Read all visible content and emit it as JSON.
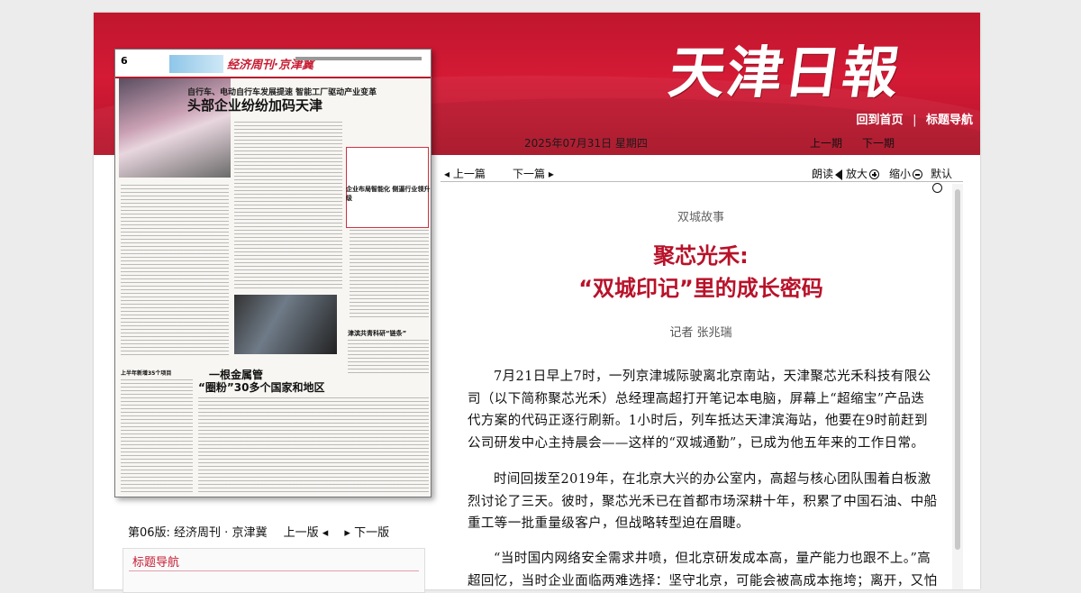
{
  "header": {
    "logo": "天津日報",
    "nav_home": "回到首页",
    "nav_sep": "|",
    "nav_titles": "标题导航",
    "date": "2025年07月31日 星期四",
    "prev_page": "上一期",
    "next_page": "下一期"
  },
  "paper_thumb": {
    "page_num": "6",
    "column": "经济周刊·京津冀",
    "subhead": "自行车、电动自行车发展提速 智能工厂驱动产业变革",
    "headline": "头部企业纷纷加码天津",
    "headline2": "一根金属管",
    "headline3": "“圈粉”30多个国家和地区",
    "side1": "津滨共青科研“链条”",
    "side2": "企业布局智能化 侧逼行业领升级",
    "side3": "上半年新增35个项目"
  },
  "pager": {
    "label": "第06版: 经济周刊 · 京津冀",
    "prev": "上一版",
    "next": "下一版"
  },
  "nav_box": {
    "title": "标题导航"
  },
  "article_bar": {
    "prev": "上一篇",
    "next": "下一篇",
    "read": "朗读",
    "zoom_in": "放大",
    "zoom_out": "缩小",
    "default": "默认"
  },
  "article": {
    "kicker": "双城故事",
    "title_line1": "聚芯光禾:",
    "title_line2": "“双城印记”里的成长密码",
    "author": "记者  张兆瑞",
    "paragraphs": [
      "7月21日早上7时，一列京津城际驶离北京南站，天津聚芯光禾科技有限公司（以下简称聚芯光禾）总经理高超打开笔记本电脑，屏幕上“超缩宝”产品迭代方案的代码正逐行刷新。1小时后，列车抵达天津滨海站，他要在9时前赶到公司研发中心主持晨会——这样的“双城通勤”，已成为他五年来的工作日常。",
      "时间回拨至2019年，在北京大兴的办公室内，高超与核心团队围着白板激烈讨论了三天。彼时，聚芯光禾已在首都市场深耕十年，积累了中国石油、中船重工等一批重量级客户，但战略转型迫在眉睫。",
      "“当时国内网络安全需求井喷，但北京研发成本高，量产能力也跟不上。”高超回忆，当时企业面临两难选择：坚守北京，可能会被高成本拖垮；离开，又怕丢失多年积"
    ]
  }
}
